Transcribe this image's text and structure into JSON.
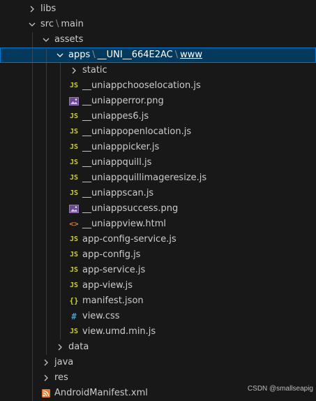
{
  "tree": {
    "libs": "libs",
    "src": "src",
    "main": "main",
    "assets": "assets",
    "apps": "apps",
    "uni_id": "__UNI__664E2AC",
    "www": "www",
    "static": "static",
    "files": [
      {
        "name": "__uniappchooselocation.js",
        "icon": "js-icon"
      },
      {
        "name": "__uniapperror.png",
        "icon": "image-icon"
      },
      {
        "name": "__uniappes6.js",
        "icon": "js-icon"
      },
      {
        "name": "__uniappopenlocation.js",
        "icon": "js-icon"
      },
      {
        "name": "__uniapppicker.js",
        "icon": "js-icon"
      },
      {
        "name": "__uniappquill.js",
        "icon": "js-icon"
      },
      {
        "name": "__uniappquillimageresize.js",
        "icon": "js-icon"
      },
      {
        "name": "__uniappscan.js",
        "icon": "js-icon"
      },
      {
        "name": "__uniappsuccess.png",
        "icon": "image-icon"
      },
      {
        "name": "__uniappview.html",
        "icon": "html-icon"
      },
      {
        "name": "app-config-service.js",
        "icon": "js-icon"
      },
      {
        "name": "app-config.js",
        "icon": "js-icon"
      },
      {
        "name": "app-service.js",
        "icon": "js-icon"
      },
      {
        "name": "app-view.js",
        "icon": "js-icon"
      },
      {
        "name": "manifest.json",
        "icon": "json-icon"
      },
      {
        "name": "view.css",
        "icon": "css-icon"
      },
      {
        "name": "view.umd.min.js",
        "icon": "js-icon"
      }
    ],
    "data": "data",
    "java": "java",
    "res": "res",
    "android_manifest": "AndroidManifest.xml"
  },
  "icons": {
    "js_text": "JS",
    "json_text": "{}",
    "css_text": "#",
    "html_text": "<>"
  },
  "colors": {
    "background": "#181818",
    "selection": "#04395e",
    "selection_border": "#0078d4",
    "js_icon": "#cbcb41",
    "css_icon": "#519aba",
    "html_icon": "#e37933",
    "image_icon": "#a074c4"
  },
  "watermark": "CSDN @smallseapig"
}
